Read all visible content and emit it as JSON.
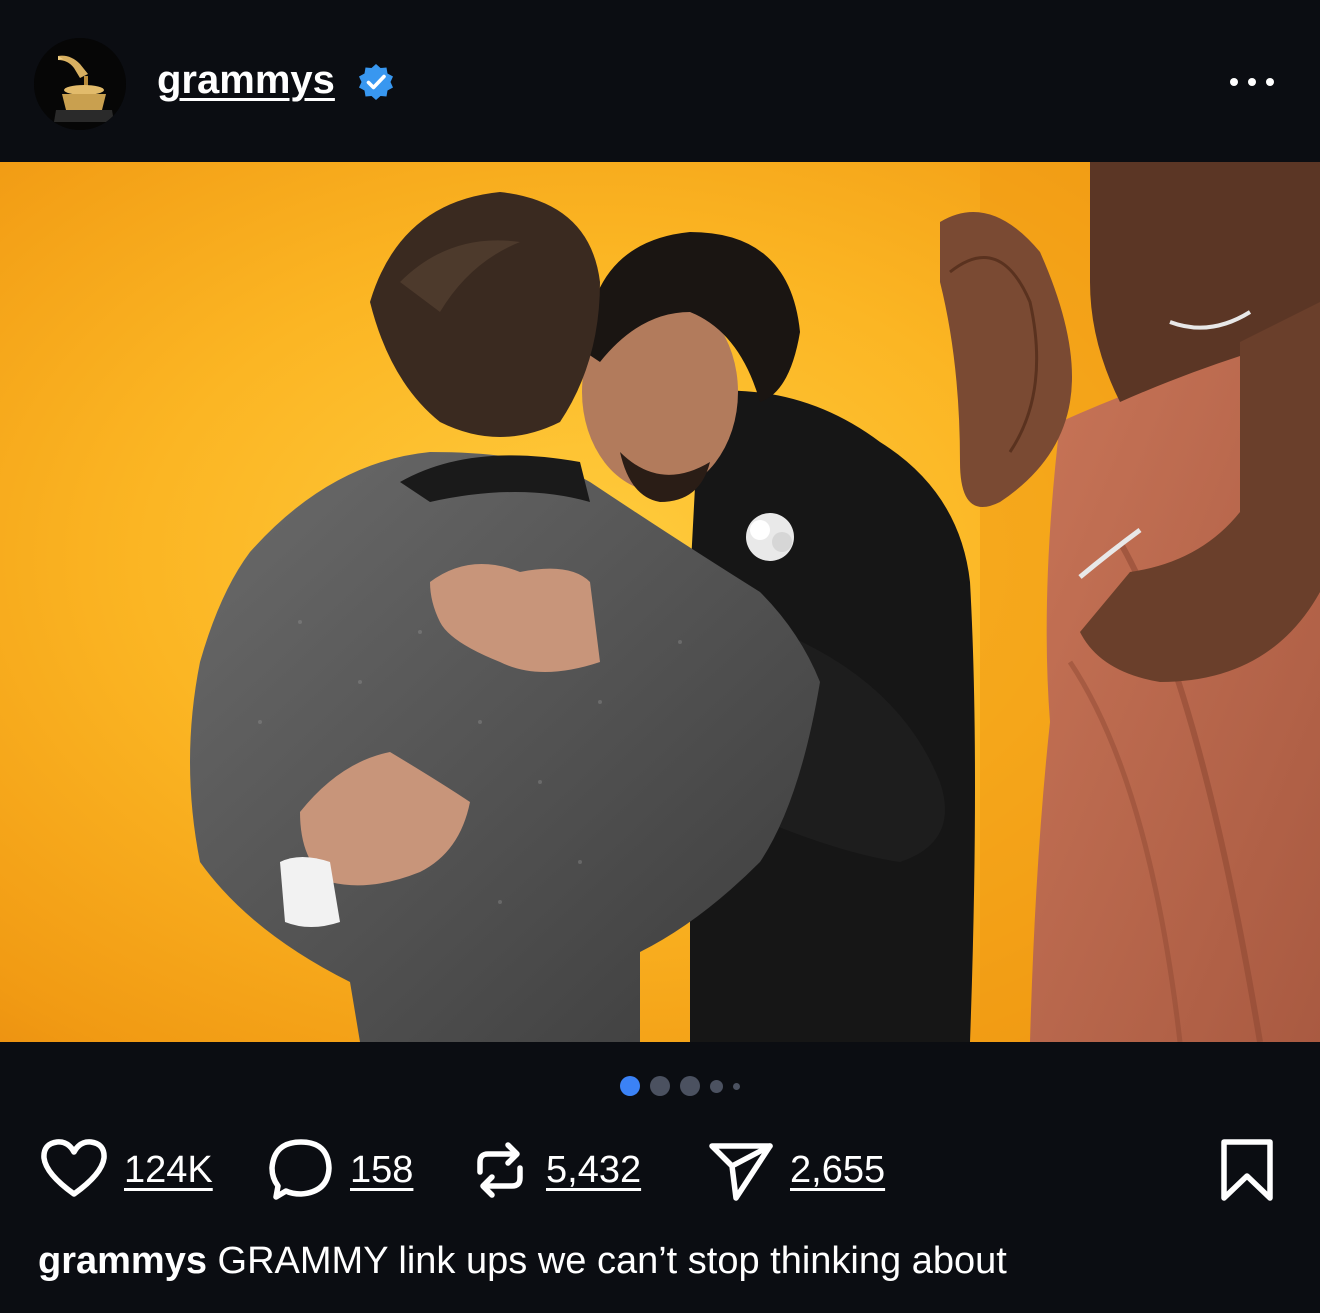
{
  "post": {
    "username": "grammys",
    "verified": true,
    "avatar_icon": "gramophone-trophy-icon",
    "more_icon": "more-options-icon",
    "carousel": {
      "total": 5,
      "active": 1
    },
    "stats": {
      "likes": "124K",
      "comments": "158",
      "reposts": "5,432",
      "shares": "2,655"
    },
    "caption": {
      "username": "grammys",
      "text": "GRAMMY link ups we can’t stop thinking about"
    }
  },
  "colors": {
    "background": "#0b0d12",
    "accent": "#3b82f6",
    "verified": "#3897f0",
    "photo_backdrop": "#fbb523"
  }
}
